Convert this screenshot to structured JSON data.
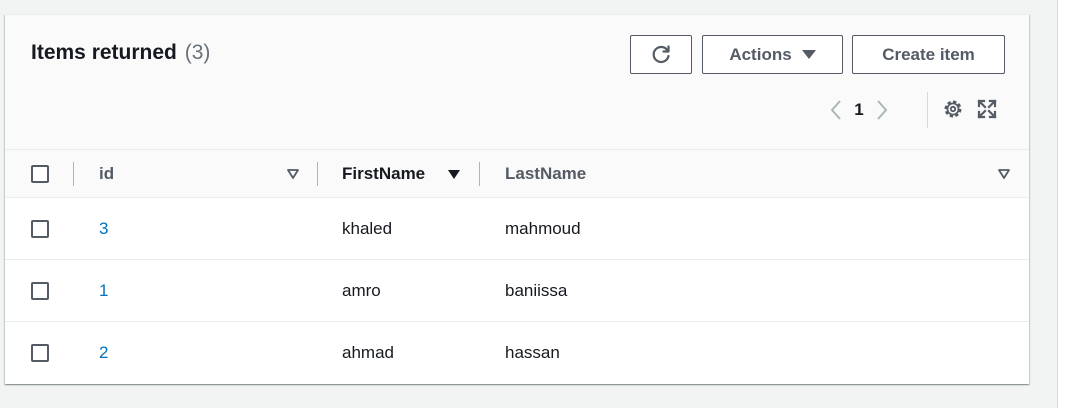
{
  "header": {
    "title": "Items returned",
    "count": "(3)"
  },
  "toolbar": {
    "refresh_icon": "refresh-icon",
    "actions_label": "Actions",
    "create_label": "Create item"
  },
  "pagination": {
    "current_page": "1"
  },
  "table": {
    "columns": [
      {
        "label": "id",
        "sort": "unsorted"
      },
      {
        "label": "FirstName",
        "sort": "descending"
      },
      {
        "label": "LastName",
        "sort": "unsorted"
      }
    ],
    "rows": [
      {
        "id": "3",
        "first_name": "khaled",
        "last_name": "mahmoud"
      },
      {
        "id": "1",
        "first_name": "amro",
        "last_name": "baniissa"
      },
      {
        "id": "2",
        "first_name": "ahmad",
        "last_name": "hassan"
      }
    ]
  },
  "colors": {
    "link": "#0073bb",
    "text": "#16191f",
    "secondary_text": "#545b64",
    "muted": "#687078"
  }
}
